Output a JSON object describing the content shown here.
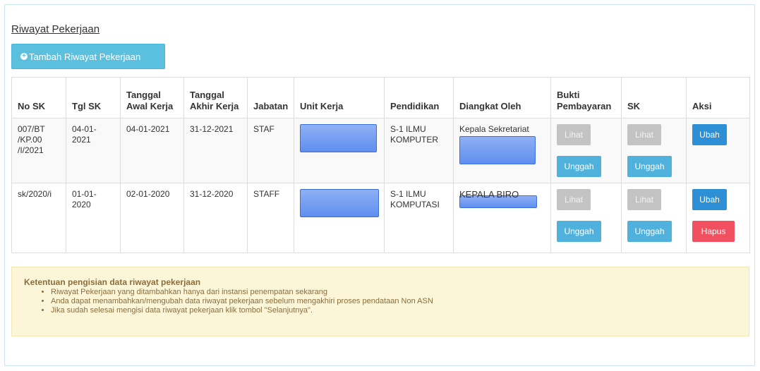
{
  "section": {
    "title": "Riwayat Pekerjaan",
    "add_button": "Tambah Riwayat Pekerjaan"
  },
  "table": {
    "headers": {
      "no_sk": "No SK",
      "tgl_sk": "Tgl SK",
      "tanggal_awal": "Tanggal Awal Kerja",
      "tanggal_akhir": "Tanggal Akhir Kerja",
      "jabatan": "Jabatan",
      "unit_kerja": "Unit Kerja",
      "pendidikan": "Pendidikan",
      "diangkat_oleh": "Diangkat Oleh",
      "bukti": "Bukti Pembayaran",
      "sk": "SK",
      "aksi": "Aksi"
    },
    "rows": [
      {
        "no_sk": "007/BT /KP.00 /I/2021",
        "tgl_sk": "04-01-2021",
        "tanggal_awal": "04-01-2021",
        "tanggal_akhir": "31-12-2021",
        "jabatan": "STAF",
        "pendidikan": "S-1 ILMU KOMPUTER",
        "diangkat_oleh": "Kepala Sekretariat"
      },
      {
        "no_sk": "sk/2020/i",
        "tgl_sk": "01-01-2020",
        "tanggal_awal": "02-01-2020",
        "tanggal_akhir": "31-12-2020",
        "jabatan": "STAFF",
        "pendidikan": "S-1 ILMU KOMPUTASI",
        "diangkat_oleh": "KEPALA BIRO"
      }
    ],
    "buttons": {
      "lihat": "Lihat",
      "unggah": "Unggah",
      "ubah": "Ubah",
      "hapus": "Hapus"
    }
  },
  "notice": {
    "title": "Ketentuan pengisian data riwayat pekerjaan",
    "items": [
      "Riwayat Pekerjaan yang ditambahkan hanya dari instansi penempatan sekarang",
      "Anda dapat menambahkan/mengubah data riwayat pekerjaan sebelum mengakhiri proses pendataan Non ASN",
      "Jika sudah selesai mengisi data riwayat pekerjaan klik tombol \"Selanjutnya\"."
    ]
  },
  "colors": {
    "info_button": "#5bc0de",
    "primary_button": "#2d8fd6",
    "danger_button": "#f0505f",
    "disabled_button": "#c3c3c3",
    "notice_bg": "#fcf6d8",
    "notice_text": "#8a6d3b"
  },
  "icons": {
    "add": "plus-circle-icon"
  }
}
